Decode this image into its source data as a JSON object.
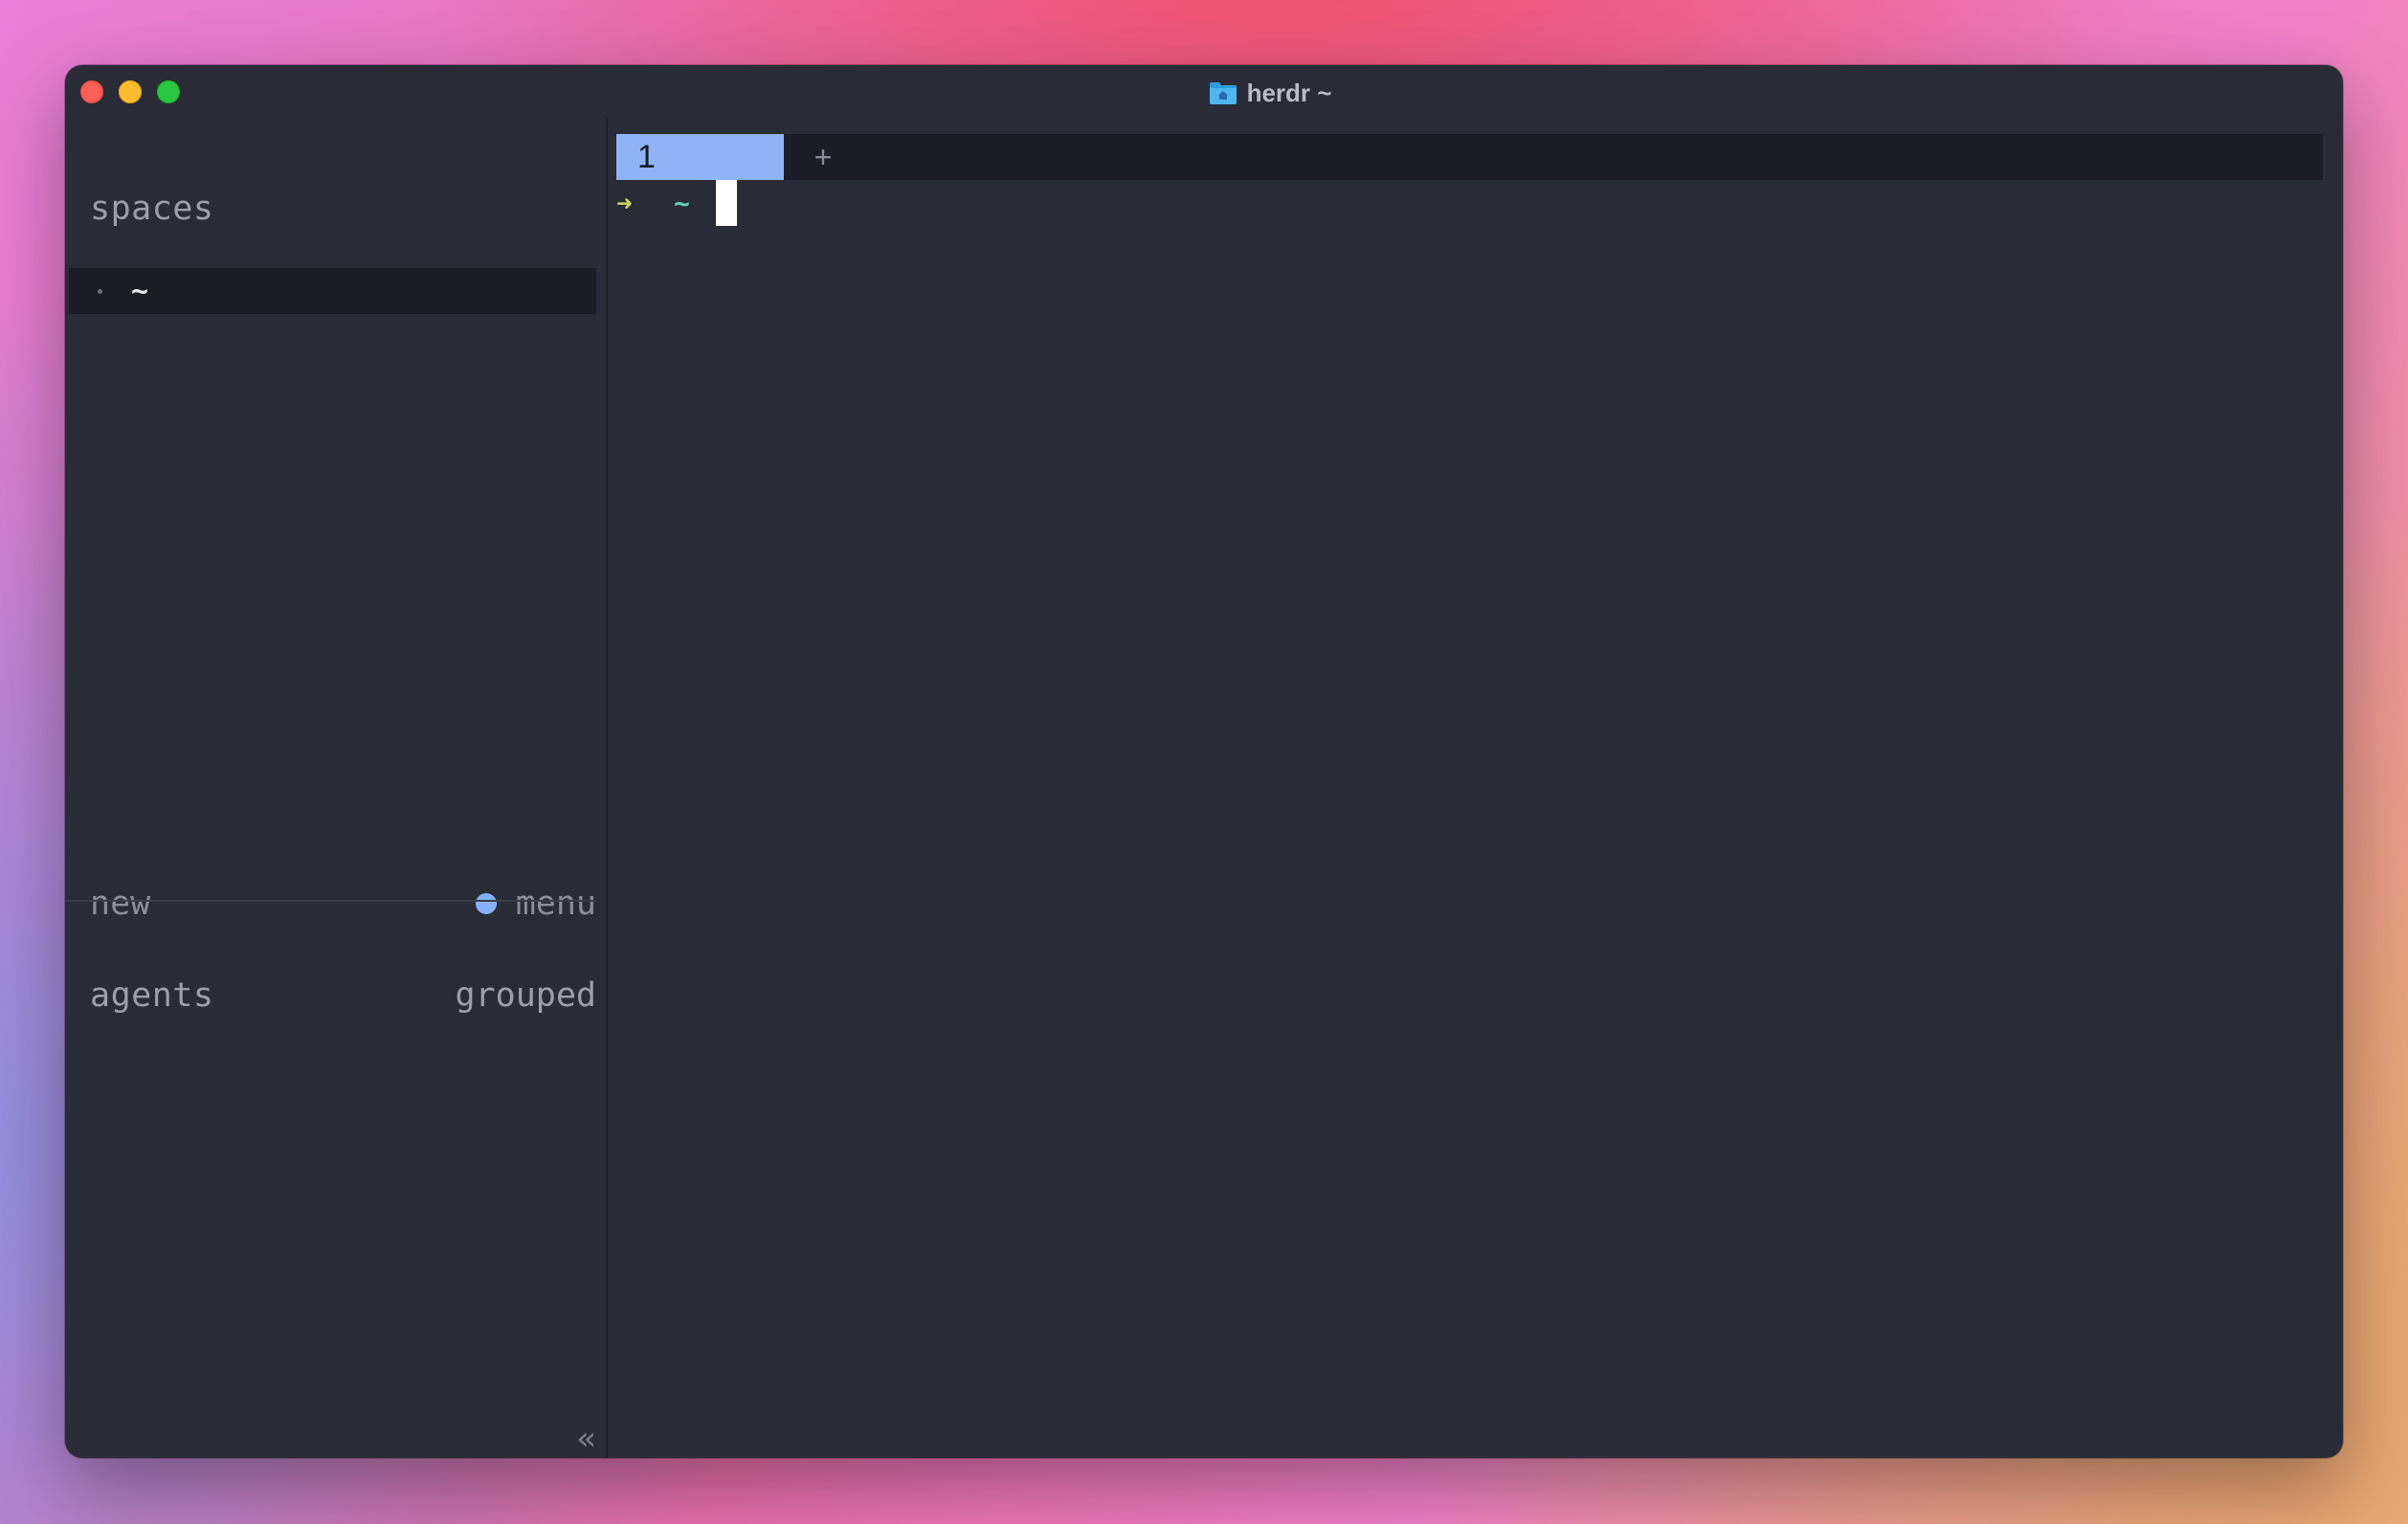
{
  "window": {
    "title": "herdr ~"
  },
  "icons": {
    "close": "close-icon",
    "minimize": "minimize-icon",
    "maximize": "maximize-icon",
    "folder": "folder-icon",
    "collapse": "double-chevron-left-icon",
    "status": "status-dot-icon"
  },
  "sidebar": {
    "spaces_heading": "spaces",
    "spaces": [
      {
        "label": "~",
        "selected": true
      }
    ],
    "new_label": "new",
    "menu_label": "menu",
    "agents_heading": "agents",
    "grouped_label": "grouped",
    "collapse_glyph": "«"
  },
  "tabs": {
    "items": [
      {
        "label": "1",
        "active": true
      }
    ],
    "add_label": "+"
  },
  "terminal": {
    "prompt_arrow": "➜",
    "prompt_dir": "~",
    "input": ""
  },
  "colors": {
    "window_bg": "#292c36",
    "accent_tab": "#8db4f7",
    "status_dot": "#86b1ff",
    "prompt_arrow": "#c9d46a",
    "prompt_dir": "#5fd1bd",
    "traffic_close": "#fe5f57",
    "traffic_minimize": "#febc2e",
    "traffic_maximize": "#28c840"
  }
}
